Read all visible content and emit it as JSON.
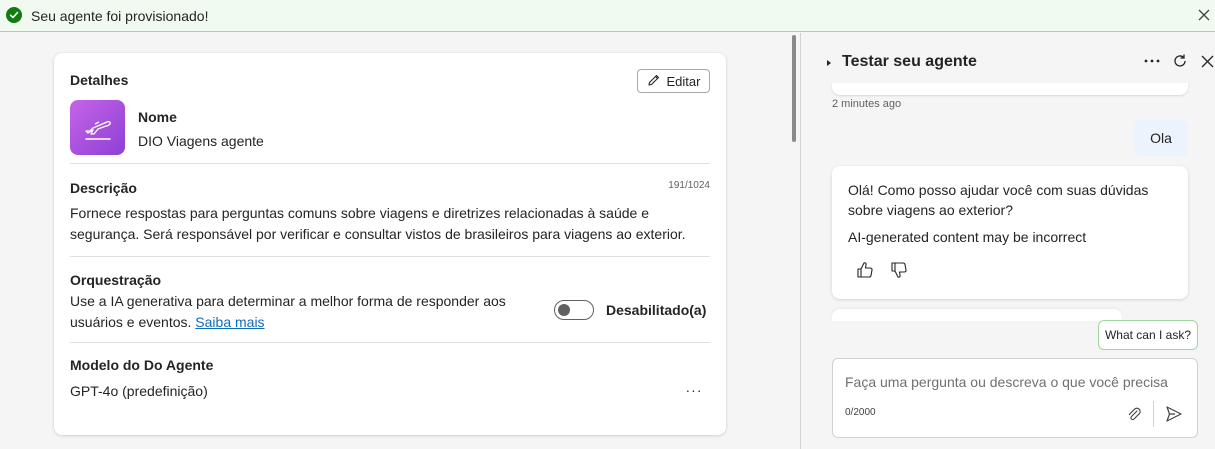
{
  "banner": {
    "message": "Seu agente foi provisionado!"
  },
  "details": {
    "title": "Detalhes",
    "edit_label": "Editar",
    "name_label": "Nome",
    "name_value": "DIO Viagens agente",
    "description_label": "Descrição",
    "description_count": "191/1024",
    "description_text": "Fornece respostas para perguntas comuns sobre viagens e diretrizes relacionadas à saúde e segurança. Será responsável por verificar e consultar vistos de brasileiros para viagens ao exterior.",
    "orchestration_label": "Orquestração",
    "orchestration_text": "Use a IA generativa para determinar a melhor forma de responder aos usuários e eventos.",
    "orchestration_link": "Saiba mais",
    "orchestration_toggle_label": "Desabilitado(a)",
    "orchestration_enabled": false,
    "model_label": "Modelo do Do Agente",
    "model_value": "GPT-4o (predefinição)",
    "model_more": "···"
  },
  "test_panel": {
    "title": "Testar seu agente",
    "timestamp": "2 minutes ago",
    "user_message": "Ola",
    "bot_message": "Olá! Como posso ajudar você com suas dúvidas sobre viagens ao exterior?",
    "bot_disclaimer": "AI-generated content may be incorrect",
    "suggestion": "What can I ask?",
    "input_placeholder": "Faça uma pergunta ou descreva o que você precisa",
    "char_count": "0/2000"
  },
  "icons": {
    "banner_status": "checkmark-circle-icon",
    "banner_close": "close-icon",
    "edit": "pencil-icon",
    "agent": "airplane-takeoff-icon",
    "panel_chevron": "chevron-right-icon",
    "panel_more": "more-horizontal-icon",
    "panel_refresh": "refresh-icon",
    "panel_close": "close-icon",
    "like": "thumbs-up-icon",
    "dislike": "thumbs-down-icon",
    "attach": "paperclip-icon",
    "send": "send-icon"
  },
  "colors": {
    "success": "#107c10",
    "agent_gradient_start": "#c564e8",
    "agent_gradient_end": "#8e3fd6",
    "link": "#0f6cbd",
    "user_bubble": "#ebf3fc"
  }
}
